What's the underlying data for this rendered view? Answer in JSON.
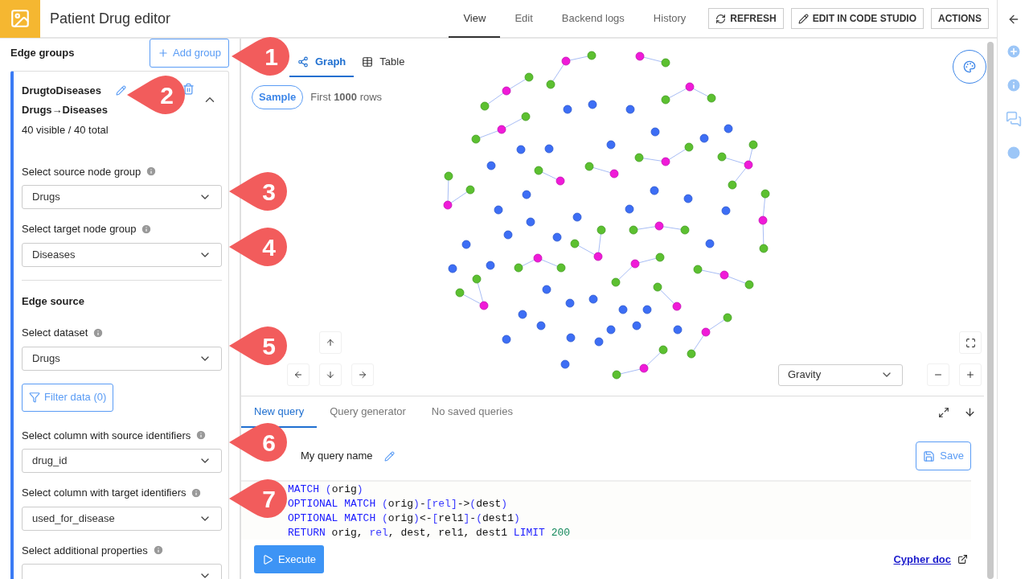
{
  "app": {
    "title": "Patient Drug editor"
  },
  "nav_tabs": [
    {
      "label": "View",
      "selected": true
    },
    {
      "label": "Edit",
      "selected": false
    },
    {
      "label": "Backend logs",
      "selected": false
    },
    {
      "label": "History",
      "selected": false
    }
  ],
  "header_buttons": [
    {
      "label": "REFRESH",
      "kind": "refresh"
    },
    {
      "label": "EDIT IN CODE STUDIO",
      "kind": "edit"
    },
    {
      "label": "ACTIONS",
      "kind": "plain"
    }
  ],
  "edge_groups": {
    "title": "Edge groups",
    "add_button": "Add group",
    "group": {
      "name": "DrugtoDiseases",
      "source": "Drugs",
      "arrow": "→",
      "target": "Diseases",
      "count": "40 visible / 40 total",
      "expanded": true,
      "node_fields": [
        {
          "label": "Select source node group",
          "value": "Drugs"
        },
        {
          "label": "Select target node group",
          "value": "Diseases"
        }
      ],
      "section": "Edge source",
      "dataset": {
        "label": "Select dataset",
        "value": "Drugs"
      },
      "filter_button": "Filter data (0)",
      "column_fields": [
        {
          "label": "Select column with source identifiers",
          "value": "drug_id"
        },
        {
          "label": "Select column with target identifiers",
          "value": "used_for_disease"
        },
        {
          "label": "Select additional properties"
        }
      ]
    }
  },
  "view_tabs": [
    {
      "label": "Graph",
      "kind": "graph",
      "selected": true
    },
    {
      "label": "Table",
      "kind": "table",
      "selected": false
    }
  ],
  "sample": {
    "label": "Sample",
    "note": "First **1000** rows"
  },
  "layout_select": "Gravity",
  "query": {
    "tabs": [
      {
        "label": "New query",
        "selected": true
      },
      {
        "label": "Query generator",
        "selected": false
      },
      {
        "label": "No saved queries",
        "selected": false
      }
    ],
    "name": "My query name",
    "save_button": "Save",
    "code": [
      [
        {
          "text": "MATCH ",
          "kind": "keyword"
        },
        {
          "text": "(",
          "kind": "punct"
        },
        {
          "text": "orig",
          "kind": "plain"
        },
        {
          "text": ")",
          "kind": "punct"
        }
      ],
      [
        {
          "text": "OPTIONAL MATCH ",
          "kind": "keyword"
        },
        {
          "text": "(",
          "kind": "punct"
        },
        {
          "text": "orig",
          "kind": "plain"
        },
        {
          "text": ")",
          "kind": "punct"
        },
        {
          "text": "-",
          "kind": "plain"
        },
        {
          "text": "[rel]",
          "kind": "punct"
        },
        {
          "text": "->",
          "kind": "plain"
        },
        {
          "text": "(",
          "kind": "punct"
        },
        {
          "text": "dest",
          "kind": "plain"
        },
        {
          "text": ")",
          "kind": "punct"
        }
      ],
      [
        {
          "text": "OPTIONAL MATCH ",
          "kind": "keyword"
        },
        {
          "text": "(",
          "kind": "punct"
        },
        {
          "text": "orig",
          "kind": "plain"
        },
        {
          "text": ")",
          "kind": "punct"
        },
        {
          "text": "<-",
          "kind": "plain"
        },
        {
          "text": "[",
          "kind": "punct"
        },
        {
          "text": "rel1",
          "kind": "plain"
        },
        {
          "text": "]",
          "kind": "punct"
        },
        {
          "text": "-",
          "kind": "plain"
        },
        {
          "text": "(",
          "kind": "punct"
        },
        {
          "text": "dest1",
          "kind": "plain"
        },
        {
          "text": ")",
          "kind": "punct"
        }
      ],
      [
        {
          "text": "RETURN ",
          "kind": "keyword"
        },
        {
          "text": "orig, ",
          "kind": "plain"
        },
        {
          "text": "rel",
          "kind": "punct"
        },
        {
          "text": ", dest, rel1, dest1 ",
          "kind": "plain"
        },
        {
          "text": "LIMIT ",
          "kind": "keyword"
        },
        {
          "text": "200",
          "kind": "number"
        }
      ]
    ],
    "execute_button": "Execute",
    "doc_link": "Cypher doc"
  },
  "callouts": [
    "1",
    "2",
    "3",
    "4",
    "5",
    "6",
    "7"
  ]
}
